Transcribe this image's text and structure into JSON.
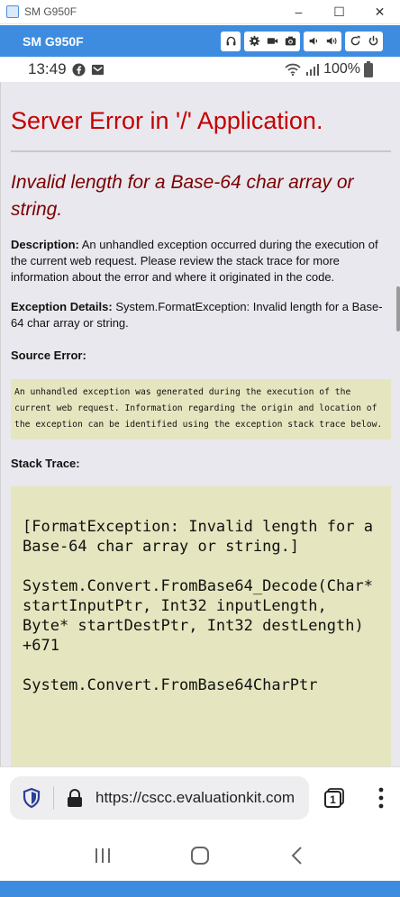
{
  "window": {
    "title": "SM G950F",
    "controls": [
      "–",
      "☐",
      "✕"
    ]
  },
  "toolbar": {
    "device_name": "SM G950F"
  },
  "statusbar": {
    "time": "13:49",
    "battery": "100%"
  },
  "page": {
    "title": "Server Error in '/' Application.",
    "error_message": "Invalid length for a Base-64 char array or string.",
    "description_label": "Description:",
    "description_text": "An unhandled exception occurred during the execution of the current web request. Please review the stack trace for more information about the error and where it originated in the code.",
    "exception_label": "Exception Details:",
    "exception_text": "System.FormatException: Invalid length for a Base-64 char array or string.",
    "source_error_label": "Source Error:",
    "source_error_text": "An unhandled exception was generated during the execution of the current web request. Information regarding the origin and location of the exception can be identified using the exception stack trace below.",
    "stack_trace_label": "Stack Trace:",
    "stack_trace_text": "[FormatException: Invalid length for a Base-64 char array or string.]\n\nSystem.Convert.FromBase64_Decode(Char* startInputPtr, Int32 inputLength, Byte* startDestPtr, Int32 destLength) +671\n\nSystem.Convert.FromBase64CharPtr"
  },
  "browser": {
    "url": "https://cscc.evaluationkit.com",
    "tab_count": "1"
  },
  "colors": {
    "title_red": "#c40000",
    "message_red": "#7a0000",
    "code_bg": "#e5e6bf",
    "toolbar_blue": "#3d8ce0"
  }
}
